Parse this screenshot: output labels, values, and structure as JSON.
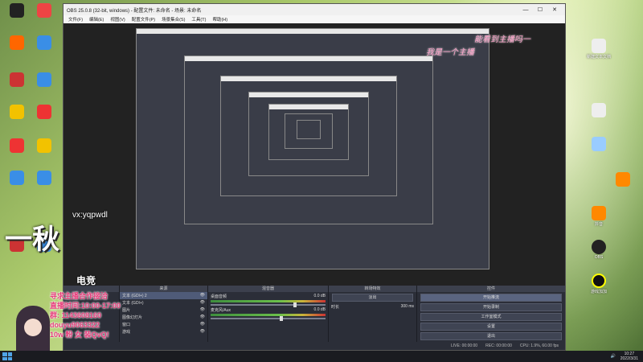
{
  "window": {
    "title": "OBS 25.0.8 (32-bit, windows) - 配置文件: 未命名 - 场景: 未命名",
    "menu": [
      "文件(F)",
      "编辑(E)",
      "视图(V)",
      "配置文件(P)",
      "场景集合(S)",
      "工具(T)",
      "帮助(H)"
    ]
  },
  "docks": {
    "sources_title": "来源",
    "sources": [
      {
        "name": "文本 (GDI+) 2",
        "selected": true
      },
      {
        "name": "文本 (GDI+)",
        "selected": false
      },
      {
        "name": "图片",
        "selected": false
      },
      {
        "name": "图像幻灯片",
        "selected": false
      },
      {
        "name": "窗口",
        "selected": false
      },
      {
        "name": "游戏",
        "selected": false
      }
    ],
    "mixer_title": "混音器",
    "mixer": [
      {
        "name": "桌面音频",
        "db": "0.0 dB",
        "level": 0.72
      },
      {
        "name": "麦克风/Aux",
        "db": "0.0 dB",
        "level": 0.6
      }
    ],
    "transitions_title": "转场特效",
    "transition_value": "淡出",
    "duration_label": "时长",
    "duration_value": "300 ms",
    "controls_title": "控件",
    "controls": [
      "开始推流",
      "开始录制",
      "工作室模式",
      "设置",
      "退出"
    ]
  },
  "status": {
    "live": "LIVE: 00:00:00",
    "rec": "REC: 00:00:00",
    "cpu": "CPU: 1.9%, 60.00 fps"
  },
  "overlay": {
    "big": "一秋",
    "wx": "vx:yqpwdl",
    "dianjing": "电竞",
    "lines": [
      "寻求主播合作接洽",
      "直播时间:10:00-17:00",
      "群: 1143608160",
      "douyu9063322",
      "10w 粉 女 装QvQ!"
    ]
  },
  "pink_texts": [
    "能看到主播吗一",
    "我是一个主播"
  ],
  "taskbar": {
    "time": "10:27",
    "date": "2022/3/31"
  },
  "right_icons": [
    "新建文本文档",
    "OBS",
    "抖音",
    "腾讯视频",
    "哔哩哔哩",
    "游戏加加"
  ]
}
